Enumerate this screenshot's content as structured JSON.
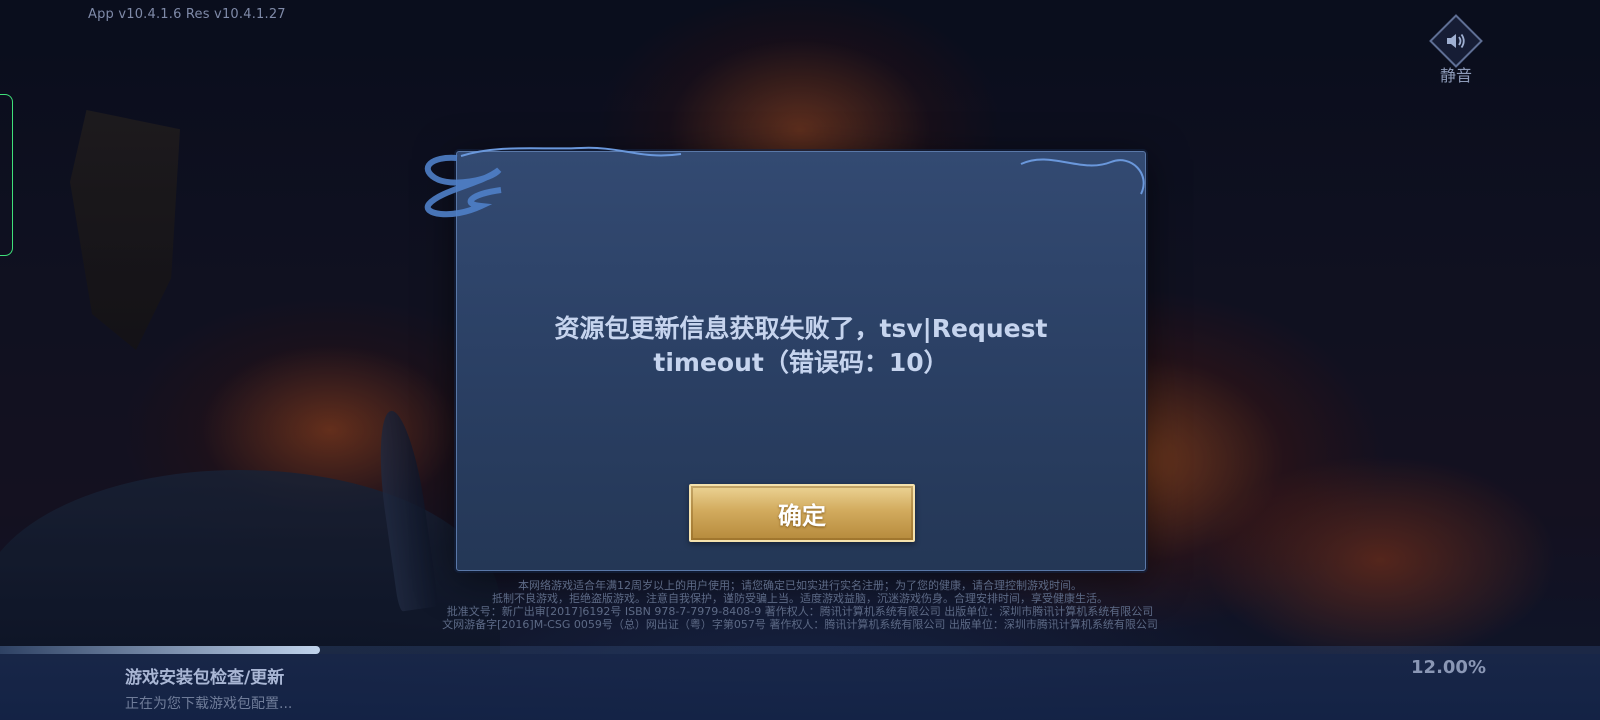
{
  "header": {
    "version": "App v10.4.1.6   Res v10.4.1.27",
    "mute_label": "静音"
  },
  "dialog": {
    "message_line1": "资源包更新信息获取失败了，tsv|Request",
    "message_line2": "timeout（错误码：10）",
    "confirm_label": "确定"
  },
  "legal": {
    "line1": "本网络游戏适合年满12周岁以上的用户使用；请您确定已如实进行实名注册；为了您的健康，请合理控制游戏时间。",
    "line2": "抵制不良游戏，拒绝盗版游戏。注意自我保护，谨防受骗上当。适度游戏益脑，沉迷游戏伤身。合理安排时间，享受健康生活。",
    "line3": "批准文号：新广出审[2017]6192号 ISBN 978-7-7979-8408-9 著作权人：腾讯计算机系统有限公司 出版单位：深圳市腾讯计算机系统有限公司",
    "line4": "文网游备字[2016]M-CSG 0059号（总）网出证（粤）字第057号 著作权人：腾讯计算机系统有限公司 出版单位：深圳市腾讯计算机系统有限公司"
  },
  "status": {
    "title": "游戏安装包检查/更新",
    "subtitle": "正在为您下载游戏包配置...",
    "percent_text": "12.00%",
    "progress_fraction": 0.2
  },
  "colors": {
    "accent_gold": "#d2ab5e",
    "dialog_bg": "#2f4469",
    "text_light": "#c6d4ee"
  },
  "icons": {
    "mute": "speaker-icon"
  }
}
